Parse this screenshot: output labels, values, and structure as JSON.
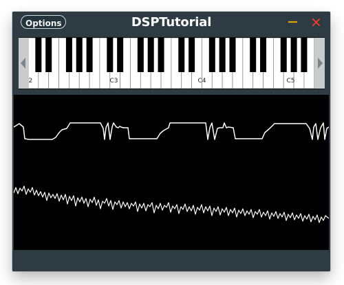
{
  "window": {
    "title": "DSPTutorial"
  },
  "toolbar": {
    "options_label": "Options",
    "minimize_icon": "minus-icon",
    "close_icon": "close-icon",
    "minimize_color": "#d9a300",
    "close_color": "#ff3b30"
  },
  "keyboard": {
    "left_arrow_icon": "chevron-left-icon",
    "right_arrow_icon": "chevron-right-icon",
    "partial_label": "2",
    "octave_labels": [
      "C3",
      "C4",
      "C5"
    ]
  },
  "waveforms": {
    "background": "#000000",
    "stroke": "#ffffff"
  }
}
